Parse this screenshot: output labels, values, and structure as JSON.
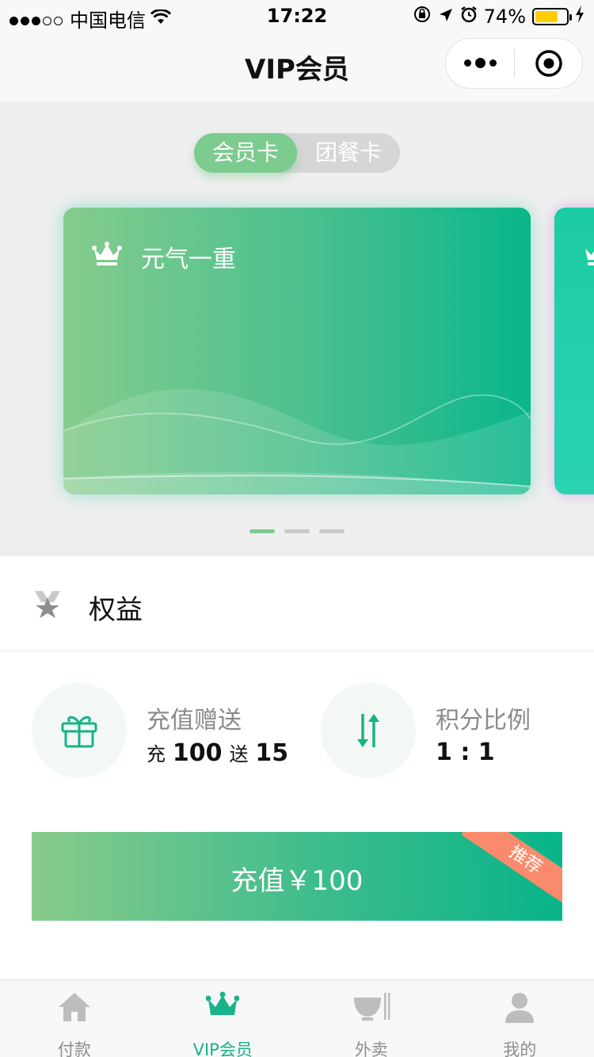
{
  "status_bar": {
    "carrier": "中国电信",
    "time": "17:22",
    "battery_percent": "74%",
    "battery_level": 0.74
  },
  "navbar": {
    "title": "VIP会员"
  },
  "card_switch": {
    "tabs": [
      "会员卡",
      "团餐卡"
    ],
    "active_index": 0
  },
  "cards": [
    {
      "name": "元气一重"
    }
  ],
  "carousel": {
    "count": 3,
    "active_index": 0
  },
  "rights": {
    "title": "权益",
    "items": [
      {
        "title": "充值赠送",
        "prefix1": "充",
        "value1": "100",
        "prefix2": "送",
        "value2": "15"
      },
      {
        "title": "积分比例",
        "value": "1 : 1"
      }
    ]
  },
  "recharge": {
    "label": "充值￥100",
    "badge": "推荐"
  },
  "tabbar": {
    "items": [
      {
        "label": "付款",
        "icon": "home-icon"
      },
      {
        "label": "VIP会员",
        "icon": "crown-icon"
      },
      {
        "label": "外卖",
        "icon": "takeout-bowl-icon"
      },
      {
        "label": "我的",
        "icon": "user-icon"
      }
    ],
    "active_index": 1
  },
  "colors": {
    "accent": "#17b389",
    "switch_active": "#7ccb8f",
    "badge": "#fb8a6c"
  }
}
